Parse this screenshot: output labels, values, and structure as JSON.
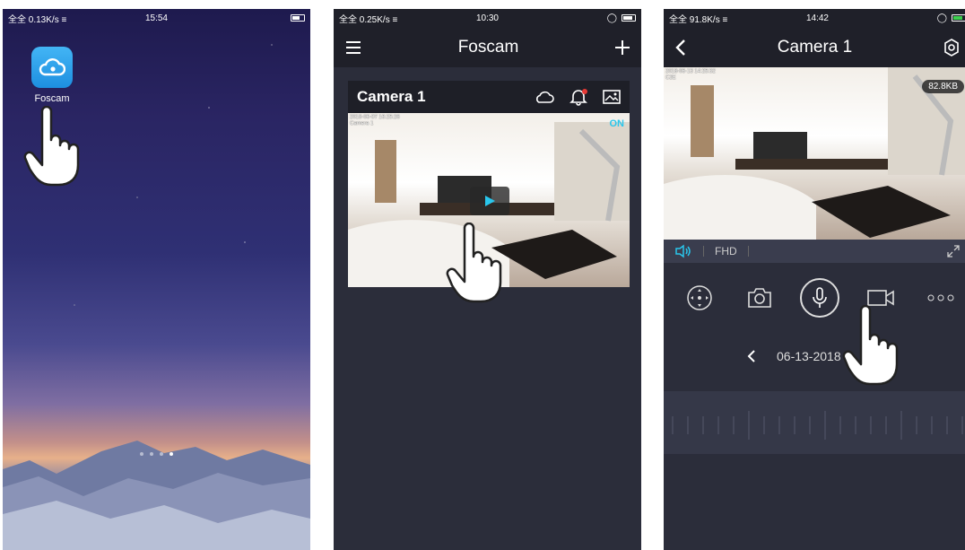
{
  "colors": {
    "accent": "#29c6ec",
    "notify_dot": "#e53935",
    "bg_dark": "#2b2d3a"
  },
  "phone1": {
    "status": {
      "left": "全全 0.13K/s ≡",
      "time": "15:54"
    },
    "app_label": "Foscam",
    "page_dots": 4
  },
  "phone2": {
    "status": {
      "left": "全全 0.25K/s ≡",
      "time": "10:30"
    },
    "title": "Foscam",
    "camera": {
      "name": "Camera 1",
      "stamp_line1": "2018-06-07 16:25:26",
      "stamp_line2": "Camera 1",
      "status": "ON"
    }
  },
  "phone3": {
    "status": {
      "left": "全全 91.8K/s ≡",
      "time": "14:42"
    },
    "title": "Camera 1",
    "stamp_line1": "2018-06-13 14:25:32",
    "stamp_line2": "C2E",
    "bitrate": "82.8KB",
    "quality": "FHD",
    "date": "06-13-2018"
  },
  "icons": [
    "home-cloud-icon",
    "cursor-hand-icon",
    "menu-icon",
    "plus-icon",
    "cloud-icon",
    "bell-icon",
    "gallery-icon",
    "play-icon",
    "back-icon",
    "settings-icon",
    "speaker-icon",
    "fullscreen-icon",
    "ptz-icon",
    "snapshot-icon",
    "mic-icon",
    "record-icon",
    "more-icon"
  ]
}
